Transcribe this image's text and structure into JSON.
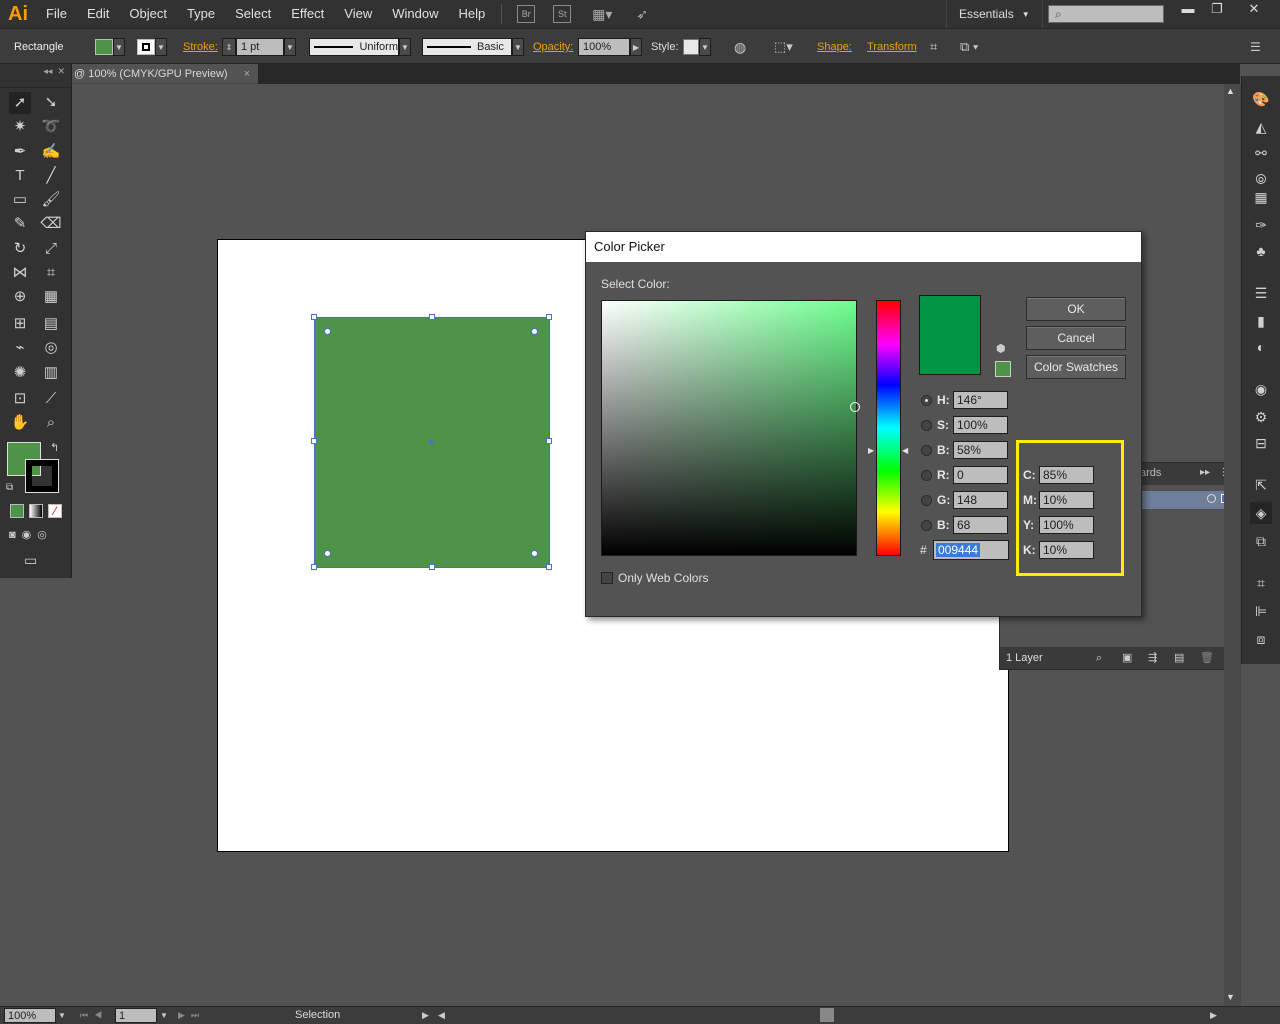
{
  "app": {
    "logo": "Ai",
    "menu": [
      "File",
      "Edit",
      "Object",
      "Type",
      "Select",
      "Effect",
      "View",
      "Window",
      "Help"
    ],
    "bridge_label": "Br",
    "stock_label": "St",
    "workspace": "Essentials",
    "window_controls": [
      "minimize-icon",
      "restore-icon",
      "close-icon"
    ]
  },
  "control_bar": {
    "tool_name": "Rectangle",
    "fill_color": "#4d9448",
    "stroke_label": "Stroke:",
    "stroke_weight": "1 pt",
    "profile_label": "Uniform",
    "brush_label": "Basic",
    "opacity_label": "Opacity:",
    "opacity_value": "100%",
    "style_label": "Style:",
    "shape_label": "Shape:",
    "transform_label": "Transform"
  },
  "document": {
    "tab_title": "@ 100% (CMYK/GPU Preview)",
    "close_glyph": "×"
  },
  "shape": {
    "fill": "#4d9448"
  },
  "color_picker": {
    "title": "Color Picker",
    "select_label": "Select Color:",
    "new_color": "#009444",
    "ok": "OK",
    "cancel": "Cancel",
    "swatches": "Color Swatches",
    "hsb": [
      {
        "label": "H:",
        "value": "146°"
      },
      {
        "label": "S:",
        "value": "100%"
      },
      {
        "label": "B:",
        "value": "58%"
      }
    ],
    "rgb": [
      {
        "label": "R:",
        "value": "0"
      },
      {
        "label": "G:",
        "value": "148"
      },
      {
        "label": "B:",
        "value": "68"
      }
    ],
    "hex_label": "#",
    "hex": "009444",
    "cmyk": [
      {
        "label": "C:",
        "value": "85%"
      },
      {
        "label": "M:",
        "value": "10%"
      },
      {
        "label": "Y:",
        "value": "100%"
      },
      {
        "label": "K:",
        "value": "10%"
      }
    ],
    "web_only": "Only Web Colors"
  },
  "layers_panel": {
    "tab_fragment": "ards",
    "count": "1 Layer"
  },
  "status_bar": {
    "zoom": "100%",
    "page": "1",
    "tool": "Selection"
  },
  "colors": {
    "highlight": "#ffed00",
    "accent_orange": "#f39c12",
    "selection_blue": "#4a72c8"
  }
}
